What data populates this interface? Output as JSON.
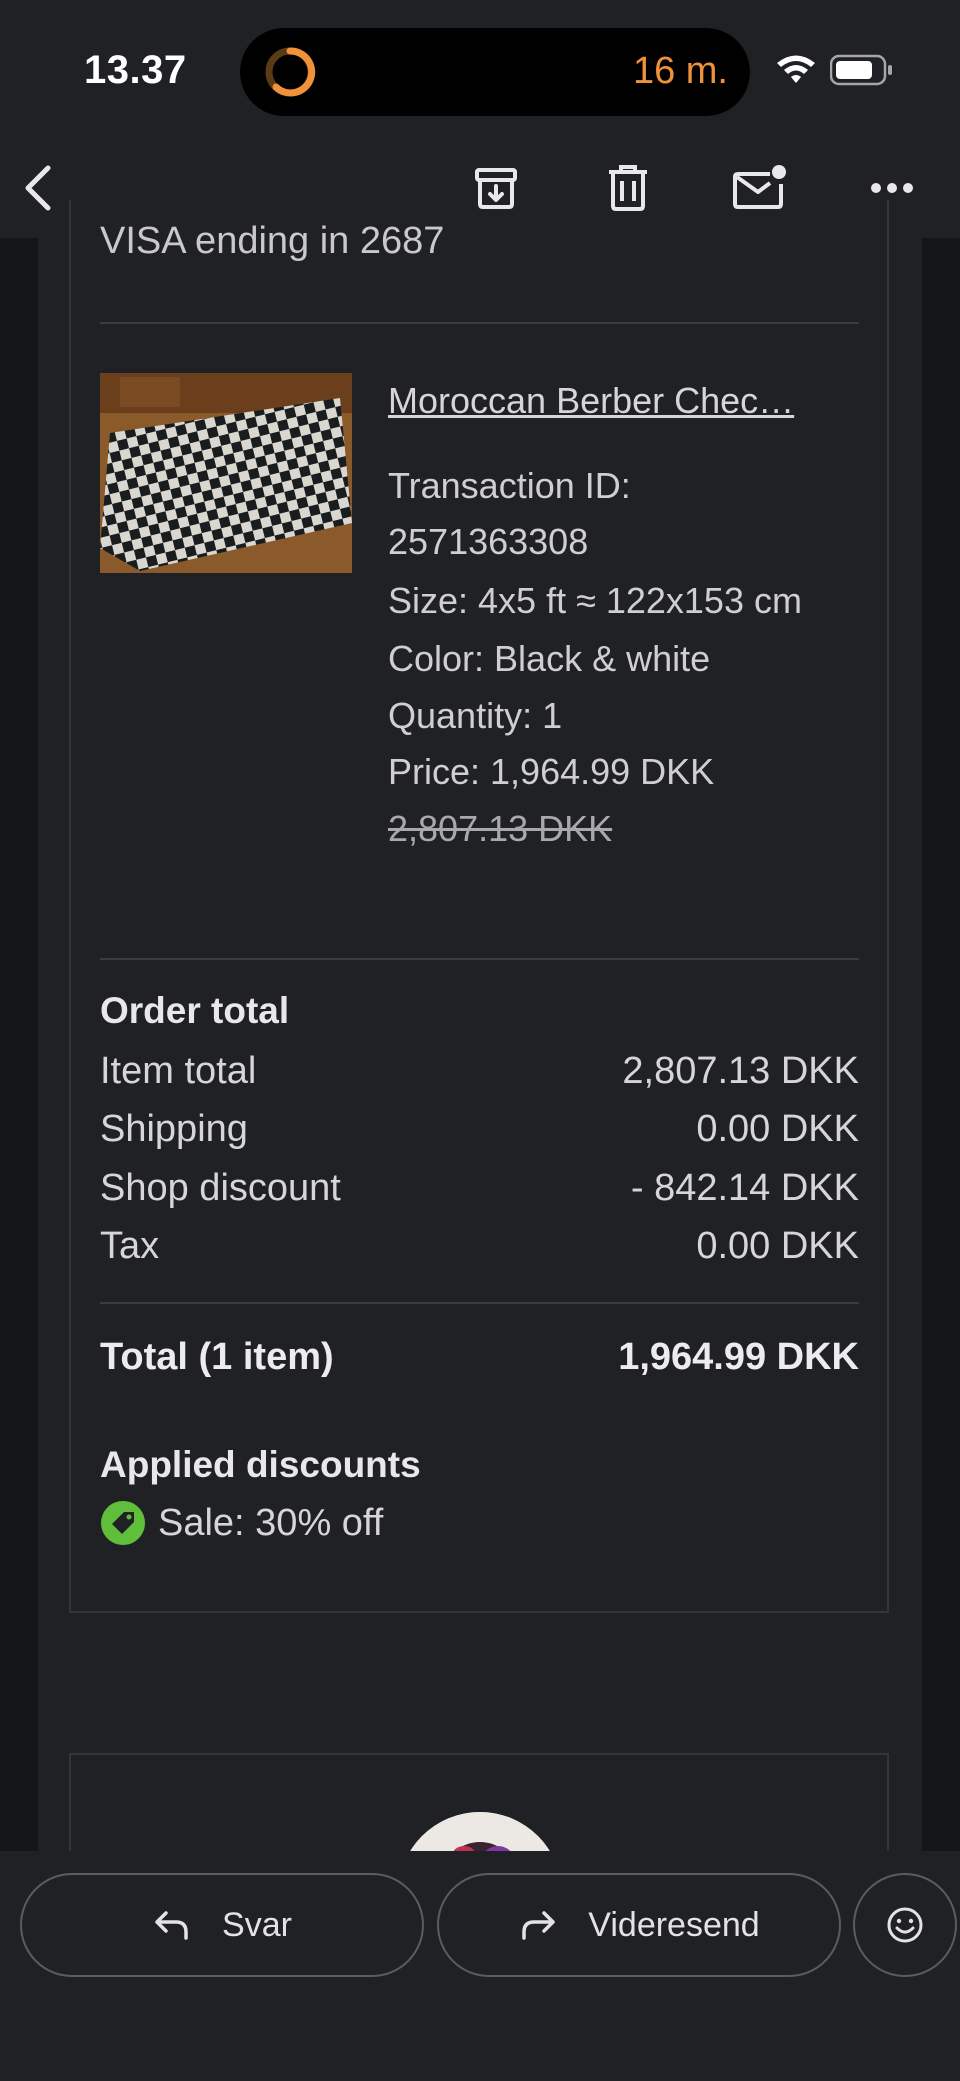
{
  "status_bar": {
    "time": "13.37",
    "island_timer": "16 m."
  },
  "toolbar": {
    "back_icon": "chevron-left-icon",
    "archive_icon": "archive-icon",
    "delete_icon": "trash-icon",
    "mark_unread_icon": "mail-unread-icon",
    "more_icon": "more-horizontal-icon"
  },
  "email": {
    "payment_line": "VISA ending in 2687",
    "product": {
      "name": "Moroccan Berber Chec…",
      "transaction_label": "Transaction ID:",
      "transaction_id": "2571363308",
      "size": "Size: 4x5 ft ≈ 122x153 cm",
      "color": "Color: Black & white",
      "quantity": "Quantity: 1",
      "price": "Price: 1,964.99 DKK",
      "original_price": "2,807.13 DKK"
    },
    "order_total": {
      "title": "Order total",
      "rows": [
        {
          "label": "Item total",
          "value": "2,807.13 DKK"
        },
        {
          "label": "Shipping",
          "value": "0.00 DKK"
        },
        {
          "label": "Shop discount",
          "value": "- 842.14 DKK"
        },
        {
          "label": "Tax",
          "value": "0.00 DKK"
        }
      ],
      "total_label": "Total (1 item)",
      "total_value": "1,964.99 DKK"
    },
    "discounts": {
      "title": "Applied discounts",
      "items": [
        {
          "icon": "tag-icon",
          "text": "Sale: 30% off",
          "color": "#5fbf3a"
        }
      ]
    }
  },
  "bottom_bar": {
    "reply_label": "Svar",
    "forward_label": "Videresend",
    "emoji_icon": "smiley-icon"
  },
  "colors": {
    "background": "#141519",
    "surface": "#202124",
    "accent_orange": "#f0923a",
    "discount_green": "#5fbf3a"
  }
}
